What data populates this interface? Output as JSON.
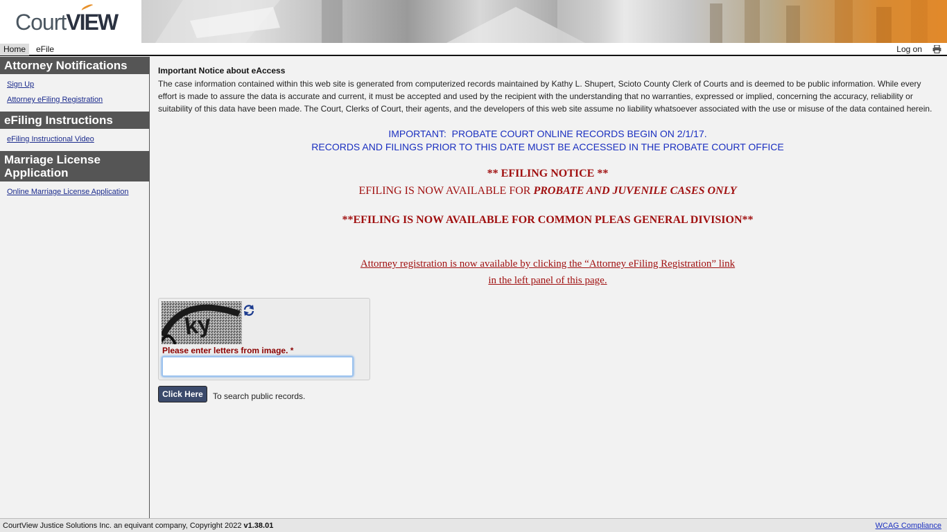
{
  "header": {
    "logo_text_1": "Court",
    "logo_text_2": "VIEW"
  },
  "nav": {
    "home": "Home",
    "efile": "eFile",
    "logon": "Log on",
    "print_icon": "printer-icon"
  },
  "sidebar": {
    "sections": [
      {
        "title": "Attorney Notifications",
        "links": [
          "Sign Up",
          "Attorney eFiling Registration"
        ]
      },
      {
        "title": "eFiling Instructions",
        "links": [
          "eFiling Instructional Video"
        ]
      },
      {
        "title": "Marriage License Application",
        "links": [
          "Online Marriage License Application"
        ]
      }
    ]
  },
  "main": {
    "notice_title": "Important Notice about eAccess",
    "notice_body": "The case information contained within this web site is generated from computerized records maintained by Kathy L. Shupert, Scioto County Clerk of Courts and is deemed to be public information. While every effort is made to assure the data is accurate and current, it must be accepted and used by the recipient with the understanding that no warranties, expressed or implied, concerning the accuracy, reliability or suitability of this data have been made. The Court, Clerks of Court, their agents, and the developers of this web site assume no liability whatsoever associated with the use or misuse of the data contained herein.",
    "probate_line_1": "IMPORTANT:  PROBATE COURT ONLINE RECORDS BEGIN ON 2/1/17.",
    "probate_line_2": "RECORDS AND FILINGS PRIOR TO THIS DATE MUST BE ACCESSED IN THE PROBATE COURT OFFICE",
    "efiling_heading": "** EFILING NOTICE **",
    "efiling_line_prefix": "EFILING IS NOW AVAILABLE FOR ",
    "efiling_line_emph": "PROBATE AND JUVENILE CASES ONLY",
    "common_pleas": "**EFILING IS NOW AVAILABLE FOR COMMON PLEAS GENERAL DIVISION**",
    "atty_reg_line_1": "Attorney registration is now available by clicking the “Attorney eFiling Registration” link",
    "atty_reg_line_2": "in the left panel of this page."
  },
  "captcha": {
    "label": "Please enter letters from image.",
    "required_marker": "*",
    "value": "",
    "refresh_icon": "refresh-icon"
  },
  "search": {
    "button_label": "Click Here",
    "hint": "To search public records."
  },
  "footer": {
    "copyright": "CourtView Justice Solutions Inc. an equivant company, Copyright 2022 ",
    "version": "v1.38.01",
    "wcag": "WCAG Compliance"
  },
  "colors": {
    "sidebar_header": "#555555",
    "link": "#1a2a8c",
    "notice_red": "#a01010",
    "probate_blue": "#1a2fc0",
    "button": "#3b4a6b"
  }
}
